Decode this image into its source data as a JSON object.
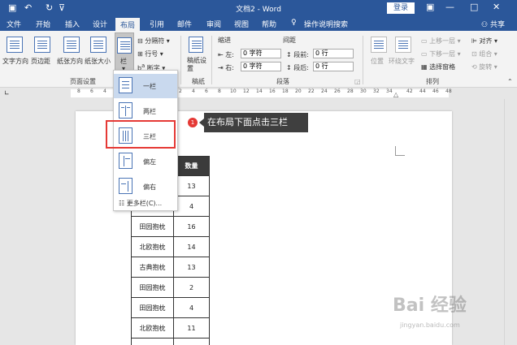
{
  "titlebar": {
    "title": "文档2 - Word",
    "login": "登录"
  },
  "tabs": [
    "文件",
    "开始",
    "插入",
    "设计",
    "布局",
    "引用",
    "邮件",
    "审阅",
    "视图",
    "帮助",
    "操作说明搜索"
  ],
  "share": "共享",
  "ribbon": {
    "page_setup": {
      "label": "页面设置",
      "items": [
        "文字方向",
        "页边距",
        "纸张方向",
        "纸张大小",
        "栏"
      ],
      "small": [
        "分隔符",
        "行号",
        "断字"
      ]
    },
    "manuscript": {
      "label": "稿纸",
      "button": "稿纸设置"
    },
    "paragraph": {
      "label": "段落",
      "indent": "缩进",
      "spacing": "间距",
      "left_label": "左:",
      "right_label": "右:",
      "before_label": "段前:",
      "after_label": "段后:",
      "left_value": "0 字符",
      "right_value": "0 字符",
      "before_value": "0 行",
      "after_value": "0 行"
    },
    "arrange": {
      "label": "排列",
      "items": [
        "位置",
        "环绕文字",
        "上移一层",
        "下移一层",
        "选择窗格",
        "对齐",
        "组合",
        "旋转"
      ]
    }
  },
  "ruler": [
    "8",
    "6",
    "4",
    "2",
    "2",
    "4",
    "6",
    "8",
    "10",
    "12",
    "14",
    "16",
    "18",
    "20",
    "22",
    "24",
    "26",
    "28",
    "30",
    "32",
    "34",
    "36",
    "38",
    "42",
    "44",
    "46",
    "48"
  ],
  "columns_menu": {
    "items": [
      "一栏",
      "两栏",
      "三栏",
      "偏左",
      "偏右"
    ],
    "more": "更多栏(C)..."
  },
  "callout": {
    "number": "1",
    "text": "在布局下面点击三栏"
  },
  "table": {
    "header": [
      "",
      "数量"
    ],
    "rows": [
      [
        "",
        "13"
      ],
      [
        "",
        "4"
      ],
      [
        "田园抱枕",
        "16"
      ],
      [
        "北欧抱枕",
        "14"
      ],
      [
        "古典抱枕",
        "13"
      ],
      [
        "田园抱枕",
        "2"
      ],
      [
        "田园抱枕",
        "4"
      ],
      [
        "北欧抱枕",
        "11"
      ],
      [
        "",
        ""
      ]
    ]
  },
  "watermark": {
    "brand": "Bai 经验",
    "url": "jingyan.baidu.com"
  }
}
